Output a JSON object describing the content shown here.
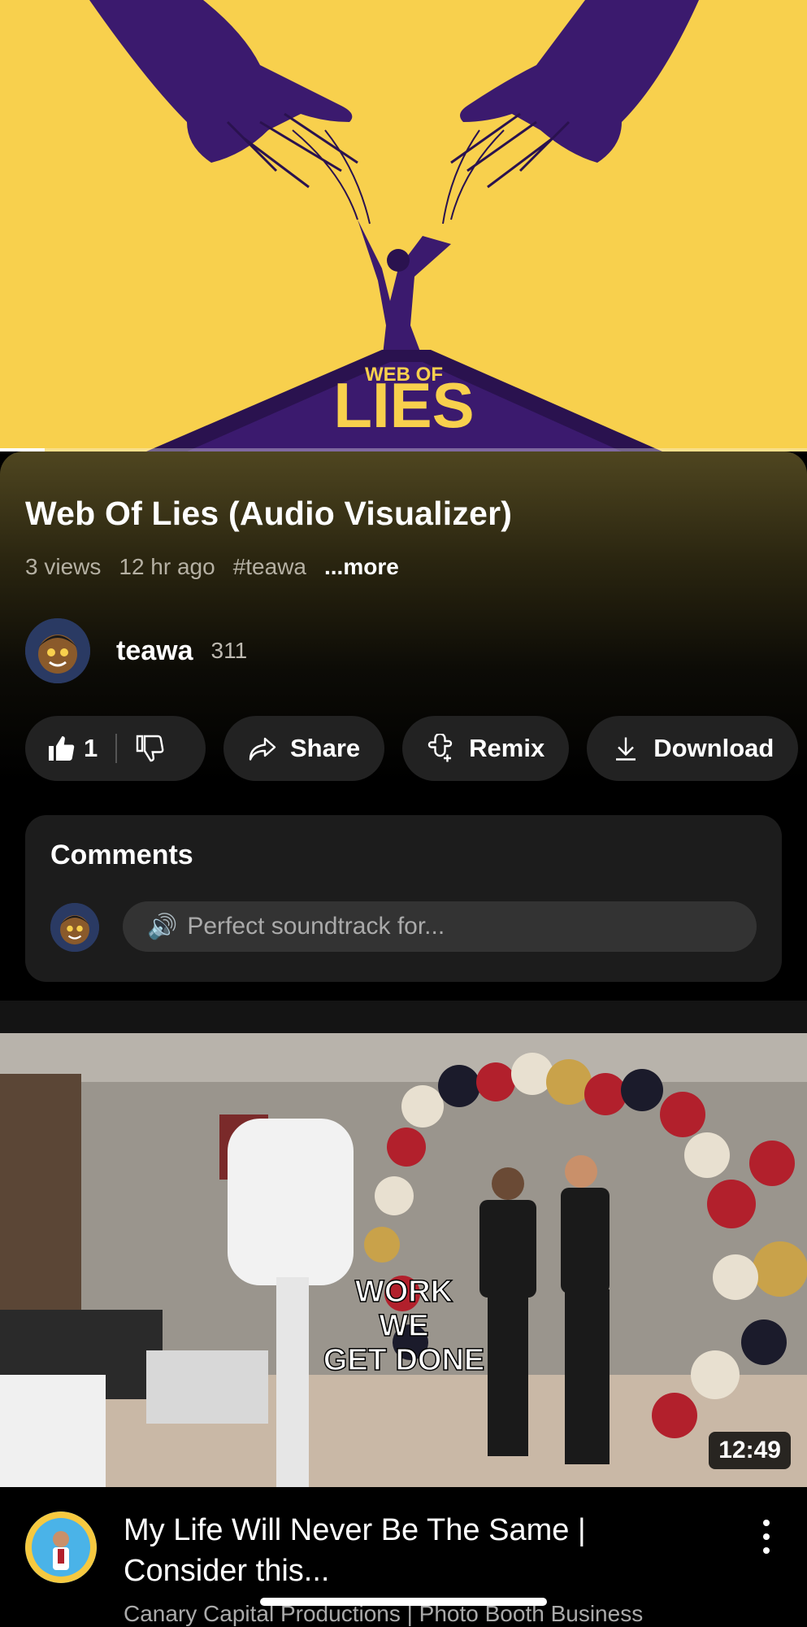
{
  "player": {
    "artwork_text_top": "WEB OF",
    "artwork_text_main": "LIES",
    "progress": 0.055
  },
  "video": {
    "title": "Web Of Lies (Audio Visualizer)",
    "views": "3 views",
    "age": "12 hr ago",
    "hashtag": "#teawa",
    "more_label": "...more"
  },
  "channel": {
    "name": "teawa",
    "subscriber_count": "311"
  },
  "actions": {
    "like_count": "1",
    "share_label": "Share",
    "remix_label": "Remix",
    "download_label": "Download"
  },
  "comments": {
    "title": "Comments",
    "input_placeholder": "Perfect soundtrack for...",
    "input_icon": "speaker-emoji",
    "input_emoji": "🔊"
  },
  "recommended": {
    "thumbnail_caption": [
      "WORK",
      "WE",
      "GET DONE"
    ],
    "duration": "12:49",
    "title": "My Life Will Never Be The Same | Consider this...",
    "channel_line": "Canary Capital Productions | Photo Booth Business"
  },
  "colors": {
    "artwork_bg": "#f8d04d",
    "artwork_purple": "#3b1a6e",
    "pill_bg": "#222222"
  }
}
